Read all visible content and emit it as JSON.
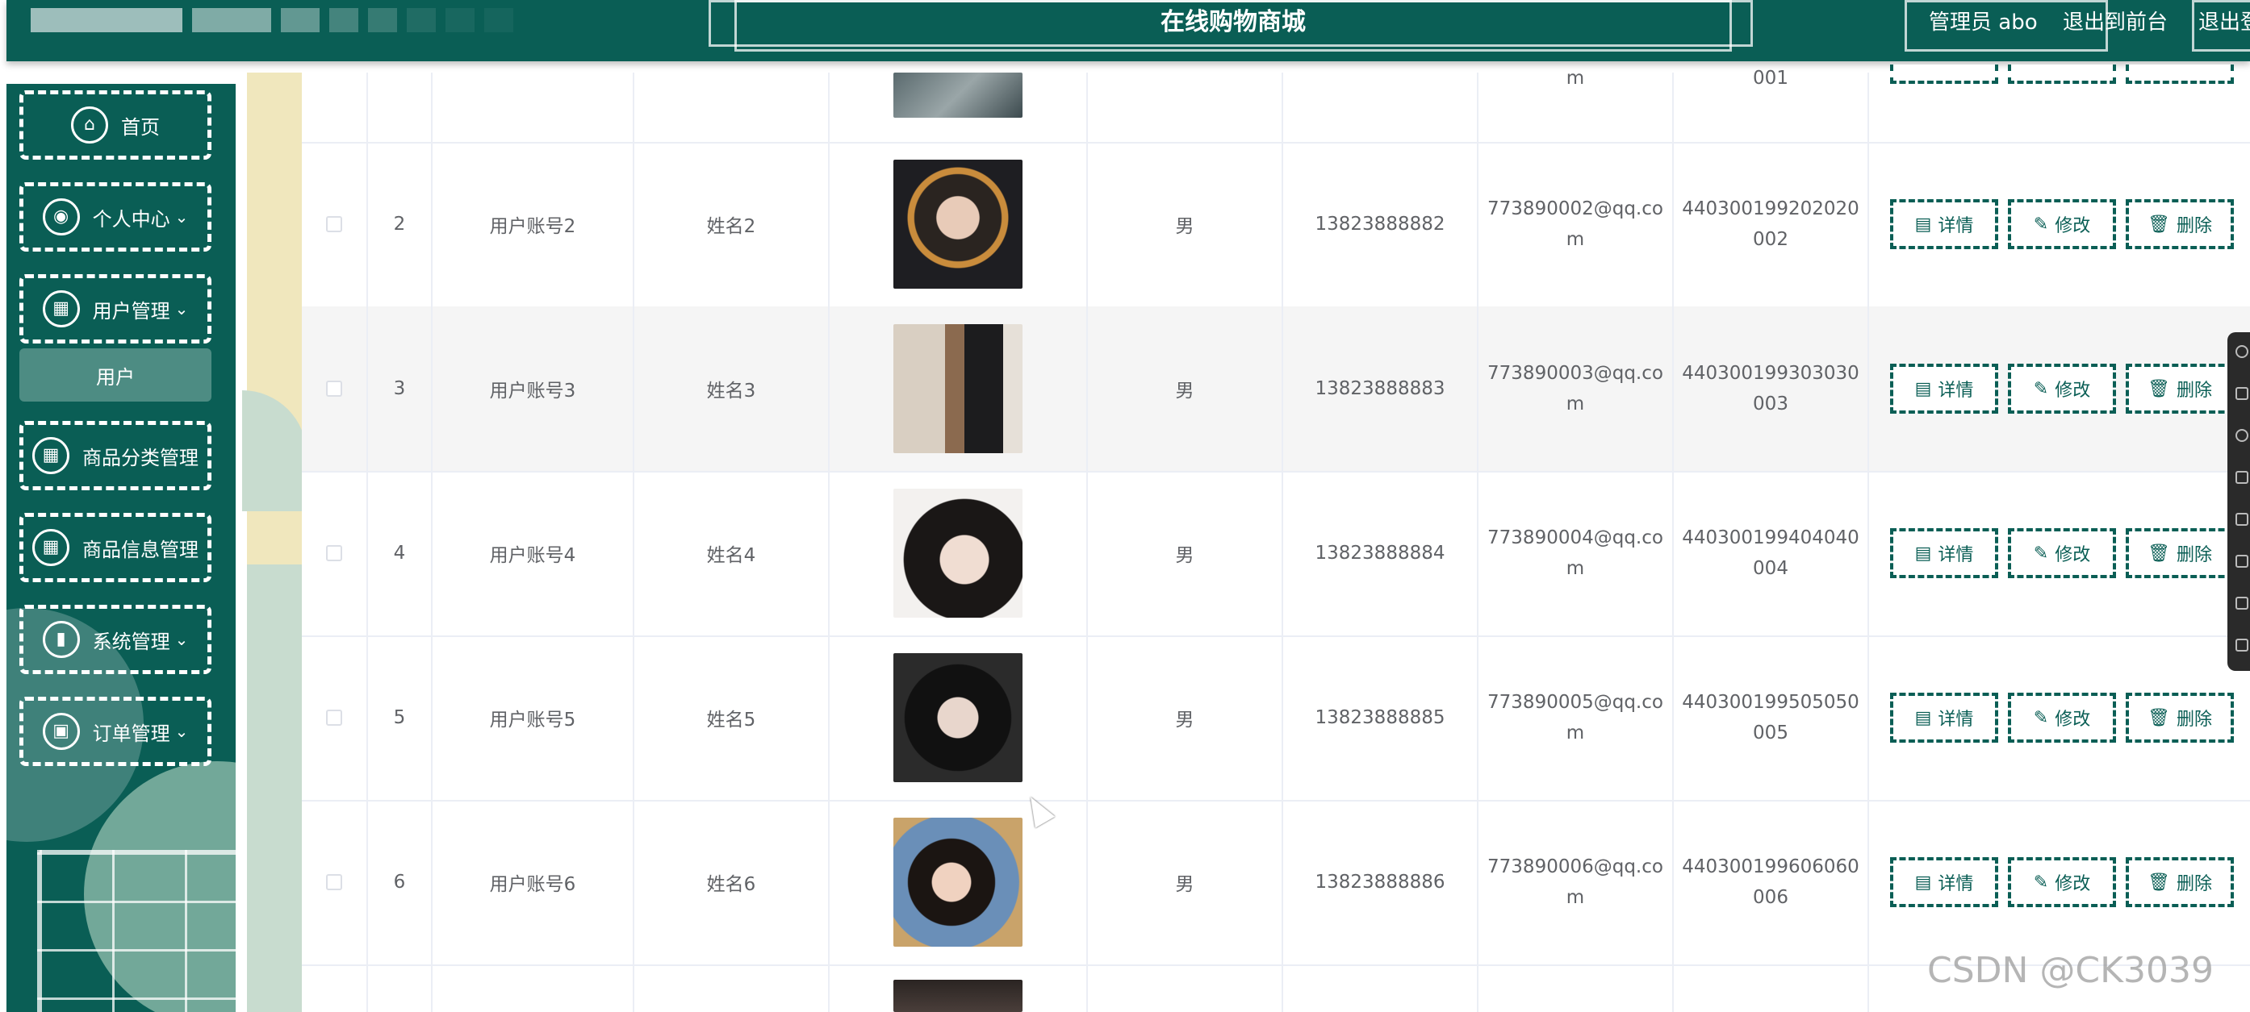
{
  "header": {
    "title": "在线购物商城",
    "admin": "管理员 abo",
    "front_link": "退出到前台",
    "logout": "退出登录",
    "color": "#0a5e55"
  },
  "sidebar": {
    "items": [
      {
        "label": "首页",
        "icon": "home-icon",
        "glyph": "⌂"
      },
      {
        "label": "个人中心",
        "icon": "user-icon",
        "glyph": "◉",
        "chevron": "⌄"
      },
      {
        "label": "用户管理",
        "icon": "grid-icon",
        "glyph": "▦",
        "chevron": "⌄"
      },
      {
        "label": "商品分类管理",
        "icon": "grid-icon",
        "glyph": "▦"
      },
      {
        "label": "商品信息管理",
        "icon": "grid-icon",
        "glyph": "▦"
      },
      {
        "label": "系统管理",
        "icon": "book-icon",
        "glyph": "▮",
        "chevron": "⌄"
      },
      {
        "label": "订单管理",
        "icon": "clipboard-icon",
        "glyph": "▣",
        "chevron": "⌄"
      }
    ],
    "submenu": {
      "label": "用户"
    }
  },
  "table": {
    "rows": [
      {
        "index": "2",
        "account": "用户账号2",
        "name": "姓名2",
        "gender": "男",
        "phone": "13823888882",
        "email_l1": "773890002@qq.co",
        "email_l2": "m",
        "id_l1": "440300199202020",
        "id_l2": "002"
      },
      {
        "index": "3",
        "account": "用户账号3",
        "name": "姓名3",
        "gender": "男",
        "phone": "13823888883",
        "email_l1": "773890003@qq.co",
        "email_l2": "m",
        "id_l1": "440300199303030",
        "id_l2": "003"
      },
      {
        "index": "4",
        "account": "用户账号4",
        "name": "姓名4",
        "gender": "男",
        "phone": "13823888884",
        "email_l1": "773890004@qq.co",
        "email_l2": "m",
        "id_l1": "440300199404040",
        "id_l2": "004"
      },
      {
        "index": "5",
        "account": "用户账号5",
        "name": "姓名5",
        "gender": "男",
        "phone": "13823888885",
        "email_l1": "773890005@qq.co",
        "email_l2": "m",
        "id_l1": "440300199505050",
        "id_l2": "005"
      },
      {
        "index": "6",
        "account": "用户账号6",
        "name": "姓名6",
        "gender": "男",
        "phone": "13823888886",
        "email_l1": "773890006@qq.co",
        "email_l2": "m",
        "id_l1": "440300199606060",
        "id_l2": "006"
      }
    ],
    "top_partial": {
      "email_tail": "m",
      "id_tail": "001"
    },
    "actions": {
      "detail": "详情",
      "edit": "修改",
      "delete": "删除"
    }
  },
  "watermark": "CSDN @CK3039"
}
